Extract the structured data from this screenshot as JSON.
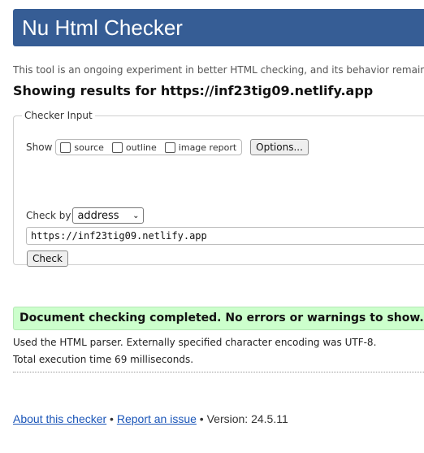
{
  "header": {
    "title": "Nu Html Checker"
  },
  "intro": {
    "text": "This tool is an ongoing experiment in better HTML checking, and its behavior remains subject to"
  },
  "results": {
    "heading": "Showing results for https://inf23tig09.netlify.app"
  },
  "checker": {
    "legend": "Checker Input",
    "show_label": "Show",
    "options": {
      "source": "source",
      "outline": "outline",
      "image_report": "image report"
    },
    "options_button": "Options...",
    "check_by_label": "Check by",
    "check_by_value": "address",
    "url_value": "https://inf23tig09.netlify.app",
    "check_button": "Check"
  },
  "status": {
    "message": "Document checking completed. No errors or warnings to show.",
    "parser_info": "Used the HTML parser. Externally specified character encoding was UTF-8.",
    "timing": "Total execution time 69 milliseconds."
  },
  "footer": {
    "about": "About this checker",
    "sep": " • ",
    "report": "Report an issue",
    "version": "Version: 24.5.11"
  },
  "colors": {
    "header_bg": "#365d95",
    "success_bg": "#ccffcc",
    "link": "#1a55b8"
  }
}
